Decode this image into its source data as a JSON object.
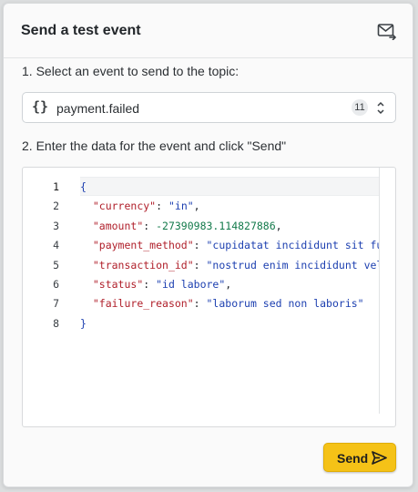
{
  "dialog": {
    "title": "Send a test event",
    "icons": {
      "mail": "mail-send-icon",
      "braces": "braces-icon",
      "updown": "chevron-updown-icon",
      "send": "send-arrow-icon"
    }
  },
  "step1": {
    "label": "1. Select an event to send to the topic:",
    "selected_event": "payment.failed",
    "event_count": "11"
  },
  "step2": {
    "label": "2. Enter the data for the event and click \"Send\""
  },
  "editor": {
    "line_numbers": [
      "1",
      "2",
      "3",
      "4",
      "5",
      "6",
      "7",
      "8"
    ],
    "lines": [
      {
        "open": "{"
      },
      {
        "key": "\"currency\"",
        "value": "\"in\"",
        "type": "string",
        "trail": ","
      },
      {
        "key": "\"amount\"",
        "value": "-27390983.114827886",
        "type": "number",
        "trail": ","
      },
      {
        "key": "\"payment_method\"",
        "value": "\"cupidatat incididunt sit fugiat\"",
        "type": "string",
        "trail": ""
      },
      {
        "key": "\"transaction_id\"",
        "value": "\"nostrud enim incididunt velit ut",
        "type": "string",
        "trail": ""
      },
      {
        "key": "\"status\"",
        "value": "\"id labore\"",
        "type": "string",
        "trail": ","
      },
      {
        "key": "\"failure_reason\"",
        "value": "\"laborum sed non laboris\"",
        "type": "string",
        "trail": ""
      },
      {
        "close": "}"
      }
    ]
  },
  "actions": {
    "send_label": "Send"
  },
  "colors": {
    "accent": "#f5c217",
    "json_key": "#b0202b",
    "json_string": "#1c3fb0",
    "json_number": "#137a4b"
  }
}
